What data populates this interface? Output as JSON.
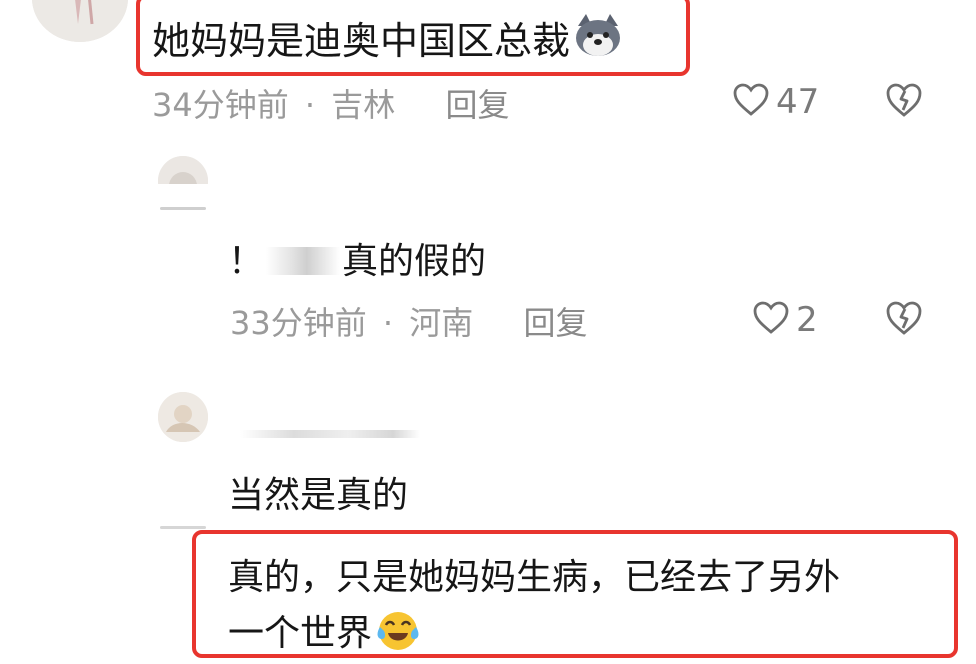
{
  "colors": {
    "highlight": "#e8352e",
    "meta": "#9a9a9a",
    "text": "#161616"
  },
  "comment1": {
    "text": "她妈妈是迪奥中国区总裁",
    "emoji": "dog-emoji",
    "time": "34分钟前",
    "sep": "·",
    "location": "吉林",
    "reply": "回复",
    "likes": "47"
  },
  "reply1": {
    "prefix": "！",
    "text": "真的假的",
    "time": "33分钟前",
    "sep": "·",
    "location": "河南",
    "reply": "回复",
    "likes": "2"
  },
  "reply2": {
    "text": "当然是真的"
  },
  "reply3": {
    "line1": "真的，只是她妈妈生病，已经去了另外",
    "line2": "一个世界",
    "emoji": "crying-laughing-emoji"
  }
}
